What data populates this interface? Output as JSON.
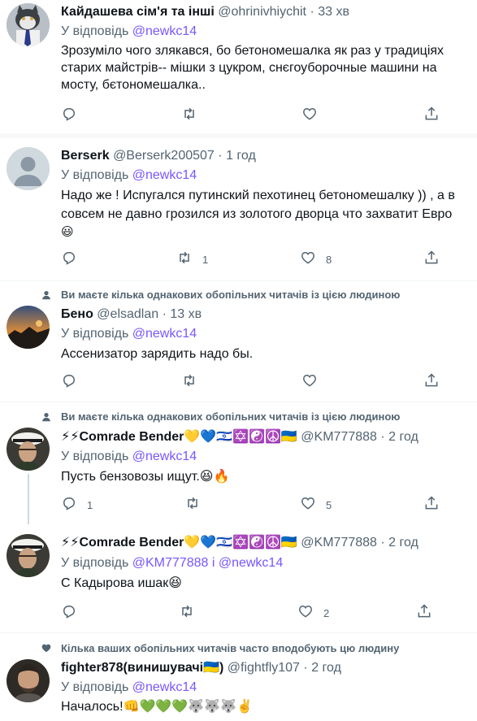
{
  "tweets": [
    {
      "name": "Кайдашева сім'я та інші",
      "handle": "@ohrinivhiychit",
      "dot": "·",
      "time": "33 хв",
      "reply_prefix": "У відповідь",
      "reply_mentions": "@newkc14",
      "text": "Зрозуміло чого злякався, бо бетономешалка як раз у традиціях старих майстрів-- мішки з цукром, снєгоуборочные машини на мосту, бєтономешалка..",
      "replies": "",
      "retweets": "",
      "likes": ""
    },
    {
      "name": "Berserk",
      "handle": "@Berserk200507",
      "dot": "·",
      "time": "1 год",
      "reply_prefix": "У відповідь",
      "reply_mentions": "@newkc14",
      "text_line1": "Надо же ! Испугался путинский пехотинец бетономешалку )) , а в",
      "text_line2": "совсем не давно грозился из золотого дворца что захватит Евро",
      "text_emoji": "😃",
      "replies": "",
      "retweets": "1",
      "likes": "8"
    },
    {
      "social": "Ви маєте кілька однакових обопільних читачів із цією людиною",
      "name": "Бено",
      "handle": "@elsadlan",
      "dot": "·",
      "time": "13 хв",
      "reply_prefix": "У відповідь",
      "reply_mentions": "@newkc14",
      "text": "Ассенизатор зарядить надо бы.",
      "replies": "",
      "retweets": "",
      "likes": ""
    },
    {
      "social": "Ви маєте кілька однакових обопільних читачів із цією людиною",
      "name": "⚡⚡Comrade Bender💛💙🇮🇱✡️☯️☮️🇺🇦",
      "handle": "@KM777888",
      "dot": "·",
      "time": "2 год",
      "reply_prefix": "У відповідь",
      "reply_mentions": "@newkc14",
      "text": "Пусть бензовозы ищут.😆🔥",
      "replies": "1",
      "retweets": "",
      "likes": "5"
    },
    {
      "name": "⚡⚡Comrade Bender💛💙🇮🇱✡️☯️☮️🇺🇦",
      "handle": "@KM777888",
      "dot": "·",
      "time": "2 год",
      "reply_prefix": "У відповідь",
      "reply_mentions": "@KM777888 і @newkc14",
      "text": "С Кадырова ишак😆",
      "replies": "",
      "retweets": "",
      "likes": "2"
    },
    {
      "social": "Кілька ваших обопільних читачів часто вподобують цю людину",
      "name": "fighter878(винишувачі🇺🇦)",
      "handle": "@fightfly107",
      "dot": "·",
      "time": "2 год",
      "reply_prefix": "У відповідь",
      "reply_mentions": "@newkc14",
      "text": "Началось!👊💚💚💚🐺🐺🐺✌️"
    }
  ],
  "icons": {
    "reply": "reply-icon",
    "retweet": "retweet-icon",
    "like": "heart-icon",
    "share": "share-icon",
    "social_person": "person-icon",
    "social_heart": "heart-filled-icon"
  },
  "colors": {
    "text": "#0f1419",
    "secondary": "#536471",
    "mention": "#7856ff",
    "divider": "#eff3f4",
    "thread_line": "#cfd9de"
  }
}
